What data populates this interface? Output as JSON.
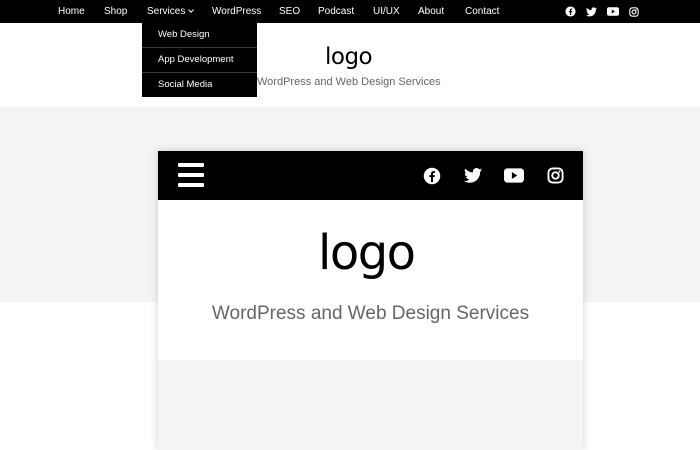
{
  "nav": {
    "items": [
      {
        "label": "Home"
      },
      {
        "label": "Shop"
      },
      {
        "label": "Services"
      },
      {
        "label": "WordPress"
      },
      {
        "label": "SEO"
      },
      {
        "label": "Podcast"
      },
      {
        "label": "UI/UX"
      },
      {
        "label": "About"
      },
      {
        "label": "Contact"
      }
    ],
    "social_icons": [
      "facebook-icon",
      "twitter-icon",
      "youtube-icon",
      "instagram-icon"
    ]
  },
  "dropdown": {
    "items": [
      {
        "label": "Web Design"
      },
      {
        "label": "App Development"
      },
      {
        "label": "Social Media"
      }
    ]
  },
  "header": {
    "logo": "logo",
    "tagline": "WordPress and Web Design Services"
  },
  "card": {
    "logo": "logo",
    "tagline": "WordPress and Web Design Services",
    "menu_icon": "hamburger-icon",
    "social_icons": [
      "facebook-icon",
      "twitter-icon",
      "youtube-icon",
      "instagram-icon"
    ]
  },
  "colors": {
    "nav_bg": "#000000",
    "page_grey": "#f4f4f4",
    "tagline_text": "#666666"
  }
}
